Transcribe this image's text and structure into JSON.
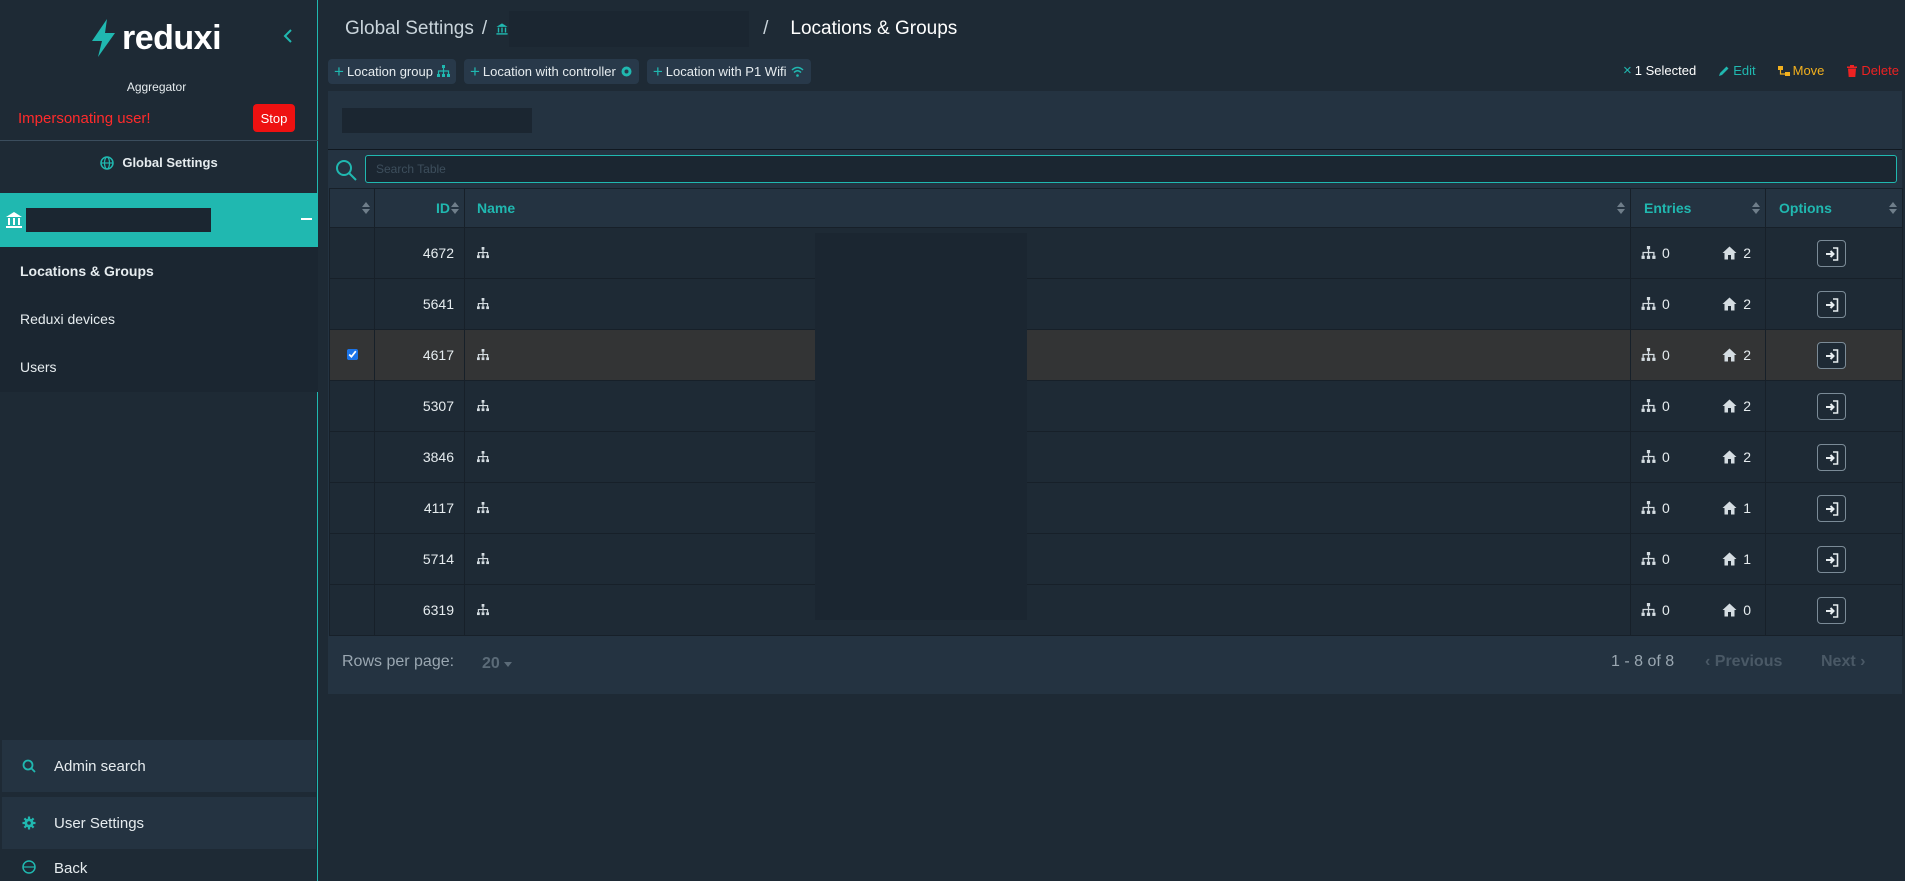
{
  "app": {
    "brand": "reduxi",
    "role": "Aggregator"
  },
  "impersonation": {
    "text": "Impersonating user!",
    "stop_label": "Stop"
  },
  "sidebar": {
    "global_settings": "Global Settings",
    "sub_items": [
      {
        "label": "Locations & Groups",
        "active": true
      },
      {
        "label": "Reduxi devices",
        "active": false
      },
      {
        "label": "Users",
        "active": false
      }
    ],
    "bottom": {
      "admin_search": "Admin search",
      "user_settings": "User Settings",
      "back": "Back"
    }
  },
  "breadcrumb": {
    "root": "Global Settings",
    "sep": "/",
    "current": "Locations & Groups"
  },
  "toolbar": {
    "location_group": "Location group",
    "location_controller": "Location with controller",
    "location_p1": "Location with P1 Wifi"
  },
  "selection": {
    "selected": "1 Selected",
    "edit": "Edit",
    "move": "Move",
    "delete": "Delete"
  },
  "search": {
    "placeholder": "Search Table"
  },
  "table": {
    "headers": {
      "id": "ID",
      "name": "Name",
      "entries": "Entries",
      "options": "Options"
    },
    "rows": [
      {
        "id": "4672",
        "groups": "0",
        "homes": "2",
        "checked": false
      },
      {
        "id": "5641",
        "groups": "0",
        "homes": "2",
        "checked": false
      },
      {
        "id": "4617",
        "groups": "0",
        "homes": "2",
        "checked": true
      },
      {
        "id": "5307",
        "groups": "0",
        "homes": "2",
        "checked": false
      },
      {
        "id": "3846",
        "groups": "0",
        "homes": "2",
        "checked": false
      },
      {
        "id": "4117",
        "groups": "0",
        "homes": "1",
        "checked": false
      },
      {
        "id": "5714",
        "groups": "0",
        "homes": "1",
        "checked": false
      },
      {
        "id": "6319",
        "groups": "0",
        "homes": "0",
        "checked": false
      }
    ]
  },
  "pagination": {
    "rows_per_page_label": "Rows per page:",
    "rows_per_page": "20",
    "range": "1 - 8 of 8",
    "previous": "Previous",
    "next": "Next"
  },
  "colors": {
    "accent": "#20b8b0",
    "danger": "#ee1111",
    "warning": "#f2b01e"
  }
}
